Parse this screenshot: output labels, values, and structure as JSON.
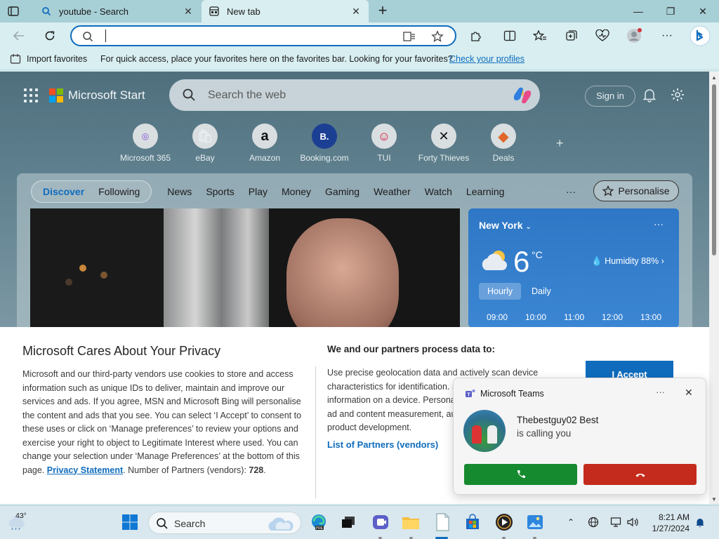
{
  "browser": {
    "tabs": [
      {
        "label": "youtube - Search",
        "icon": "search-icon"
      },
      {
        "label": "New tab",
        "icon": "new-tab-page-icon"
      }
    ],
    "address": {
      "value": "",
      "placeholder": ""
    },
    "favorites_bar": {
      "import_label": "Import favorites",
      "message": "For quick access, place your favorites here on the favorites bar. Looking for your favorites?",
      "link": "Check your profiles"
    }
  },
  "start": {
    "brand": "Microsoft Start",
    "search_placeholder": "Search the web",
    "signin": "Sign in",
    "tiles": [
      {
        "label": "Microsoft 365",
        "glyph": "◎"
      },
      {
        "label": "eBay",
        "glyph": "🛍"
      },
      {
        "label": "Amazon",
        "glyph": "a"
      },
      {
        "label": "Booking.com",
        "glyph": "B."
      },
      {
        "label": "TUI",
        "glyph": "☺"
      },
      {
        "label": "Forty Thieves",
        "glyph": "✕"
      },
      {
        "label": "Deals",
        "glyph": "◆"
      }
    ],
    "pivots": {
      "discover": "Discover",
      "following": "Following",
      "items": [
        "News",
        "Sports",
        "Play",
        "Money",
        "Gaming",
        "Weather",
        "Watch",
        "Learning"
      ],
      "more": "···",
      "personalise": "Personalise"
    },
    "weather": {
      "city": "New York",
      "temp": "6",
      "unit": "°C",
      "humidity": "Humidity 88%",
      "tabs": [
        "Hourly",
        "Daily"
      ],
      "hours": [
        "09:00",
        "10:00",
        "11:00",
        "12:00",
        "13:00"
      ]
    }
  },
  "privacy": {
    "title": "Microsoft Cares About Your Privacy",
    "body": "Microsoft and our third-party vendors use cookies to store and access information such as unique IDs to deliver, maintain and improve our services and ads. If you agree, MSN and Microsoft Bing will personalise the content and ads that you see. You can select ‘I Accept’ to consent to these uses or click on ‘Manage preferences’ to review your options and exercise your right to object to Legitimate Interest where used.  You can change your selection under ‘Manage Preferences’ at the bottom of this page.",
    "statement_link": "Privacy Statement",
    "partners_count_label": "Number of Partners (vendors):",
    "partners_count": "728",
    "purpose_title": "We and our partners process data to:",
    "purpose_text": "Use precise geolocation data and actively scan device characteristics for identification. Store and/or access information on a device. Personalised ads and content, ad and content measurement, audience insights and product development.",
    "partners_link": "List of Partners (vendors)",
    "accept_label": "I Accept"
  },
  "teams_toast": {
    "app": "Microsoft Teams",
    "more": "···",
    "caller": "Thebestguy02 Best",
    "subtitle": "is calling you"
  },
  "taskbar": {
    "weather_temp": "43°",
    "search_label": "Search",
    "time": "8:21 AM",
    "date": "1/27/2024"
  }
}
